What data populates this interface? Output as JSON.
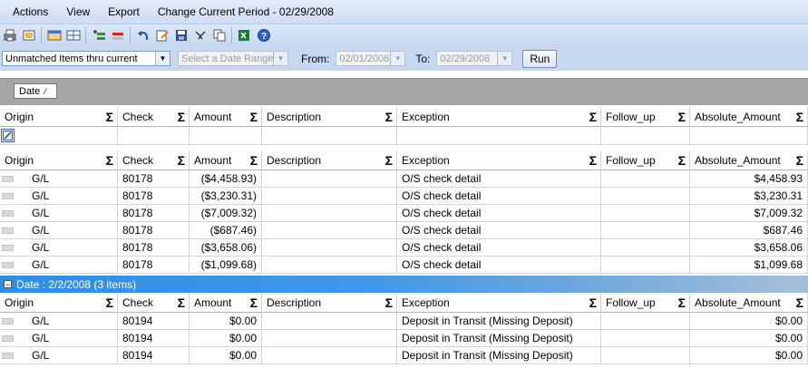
{
  "menu": {
    "items": [
      "Actions",
      "View",
      "Export",
      "Change Current Period - 02/29/2008"
    ]
  },
  "toolbar": {
    "icons": [
      "print-icon",
      "print-preview-icon",
      "layout-icon",
      "grid-icon",
      "add-row-icon",
      "delete-row-icon",
      "undo-icon",
      "edit-icon",
      "save-icon",
      "filter-icon",
      "copy-icon",
      "excel-icon",
      "help-icon"
    ]
  },
  "filter": {
    "items_select": "Unmatched Items thru current",
    "date_range_select": "Select a Date Range",
    "from_label": "From:",
    "from_value": "02/01/2008",
    "to_label": "To:",
    "to_value": "02/29/2008",
    "run_label": "Run"
  },
  "group_by": {
    "tag": "Date"
  },
  "columns": [
    "Origin",
    "Check",
    "Amount",
    "Description",
    "Exception",
    "Follow_up",
    "Absolute_Amount"
  ],
  "group1_rows": [
    {
      "origin": "G/L",
      "check": "80178",
      "amount": "($4,458.93)",
      "description": "",
      "exception": "O/S check detail",
      "follow_up": "",
      "abs": "$4,458.93"
    },
    {
      "origin": "G/L",
      "check": "80178",
      "amount": "($3,230.31)",
      "description": "",
      "exception": "O/S check detail",
      "follow_up": "",
      "abs": "$3,230.31"
    },
    {
      "origin": "G/L",
      "check": "80178",
      "amount": "($7,009.32)",
      "description": "",
      "exception": "O/S check detail",
      "follow_up": "",
      "abs": "$7,009.32"
    },
    {
      "origin": "G/L",
      "check": "80178",
      "amount": "($687.46)",
      "description": "",
      "exception": "O/S check detail",
      "follow_up": "",
      "abs": "$687.46"
    },
    {
      "origin": "G/L",
      "check": "80178",
      "amount": "($3,658.06)",
      "description": "",
      "exception": "O/S check detail",
      "follow_up": "",
      "abs": "$3,658.06"
    },
    {
      "origin": "G/L",
      "check": "80178",
      "amount": "($1,099.68)",
      "description": "",
      "exception": "O/S check detail",
      "follow_up": "",
      "abs": "$1,099.68"
    }
  ],
  "group2": {
    "label": "Date : 2/2/2008 (3 items)"
  },
  "group2_rows": [
    {
      "origin": "G/L",
      "check": "80194",
      "amount": "$0.00",
      "description": "",
      "exception": "Deposit in Transit (Missing Deposit)",
      "follow_up": "",
      "abs": "$0.00"
    },
    {
      "origin": "G/L",
      "check": "80194",
      "amount": "$0.00",
      "description": "",
      "exception": "Deposit in Transit (Missing Deposit)",
      "follow_up": "",
      "abs": "$0.00"
    },
    {
      "origin": "G/L",
      "check": "80194",
      "amount": "$0.00",
      "description": "",
      "exception": "Deposit in Transit (Missing Deposit)",
      "follow_up": "",
      "abs": "$0.00"
    }
  ]
}
